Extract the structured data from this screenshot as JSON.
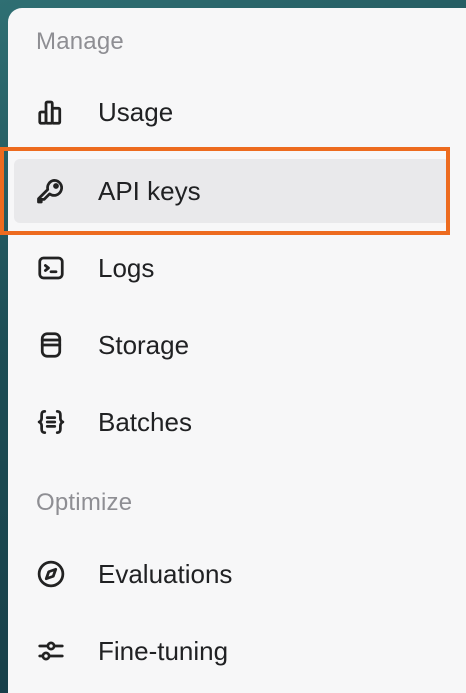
{
  "sections": [
    {
      "label": "Manage",
      "items": [
        {
          "label": "Usage",
          "icon": "bar-chart-icon"
        },
        {
          "label": "API keys",
          "icon": "key-icon",
          "active": true
        },
        {
          "label": "Logs",
          "icon": "terminal-icon"
        },
        {
          "label": "Storage",
          "icon": "database-icon"
        },
        {
          "label": "Batches",
          "icon": "braces-list-icon"
        }
      ]
    },
    {
      "label": "Optimize",
      "items": [
        {
          "label": "Evaluations",
          "icon": "compass-icon"
        },
        {
          "label": "Fine-tuning",
          "icon": "sliders-icon"
        }
      ]
    }
  ],
  "colors": {
    "highlight": "#ed6b1f",
    "active_bg": "#e9e9eb",
    "panel_bg": "#f7f7f8",
    "section_label": "#8e8e93",
    "item_text": "#202123"
  }
}
